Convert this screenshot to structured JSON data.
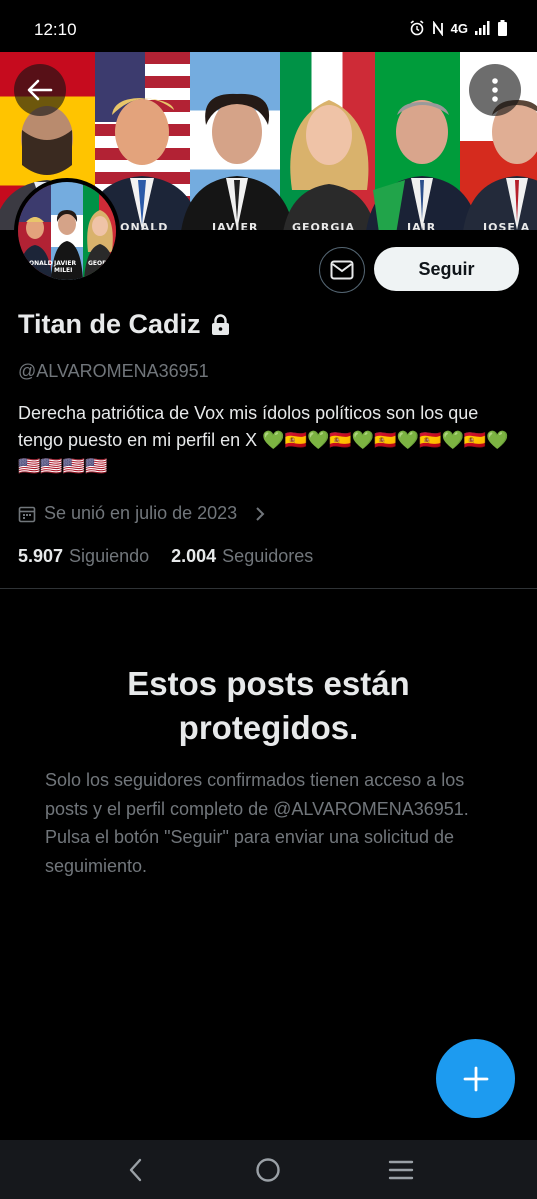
{
  "status_bar": {
    "time": "12:10",
    "network": "4G",
    "icons": [
      "alarm-icon",
      "nfc-icon",
      "signal-icon",
      "battery-icon"
    ]
  },
  "header": {
    "back_icon": "arrow-left-icon",
    "more_icon": "more-vertical-icon",
    "banner_captions": [
      "DONALD",
      "JAVIER",
      "GEORGIA",
      "JAIR",
      "JOSE A"
    ]
  },
  "avatar": {
    "captions": [
      "DONALD",
      "JAVIER MILEI",
      "GEORGIA"
    ]
  },
  "actions": {
    "message_icon": "envelope-icon",
    "follow_label": "Seguir"
  },
  "profile": {
    "display_name": "Titan de Cadiz",
    "lock_icon": "lock-icon",
    "handle": "@ALVAROMENA36951",
    "bio": "Derecha patriótica de Vox mis ídolos políticos son los que tengo puesto en mi perfil en X 💚🇪🇸💚🇪🇸💚🇪🇸💚🇪🇸💚🇪🇸💚🇺🇸🇺🇸🇺🇸🇺🇸",
    "joined": "Se unió en julio de 2023",
    "following_count": "5.907",
    "following_label": "Siguiendo",
    "followers_count": "2.004",
    "followers_label": "Seguidores"
  },
  "protected": {
    "title": "Estos posts están protegidos.",
    "description": "Solo los seguidores confirmados tienen acceso a los posts y el perfil completo de @ALVAROMENA36951. Pulsa el botón \"Seguir\" para enviar una solicitud de seguimiento."
  },
  "fab": {
    "icon": "plus-icon"
  },
  "system_nav": {
    "items": [
      "back-icon",
      "home-icon",
      "recents-icon"
    ]
  },
  "colors": {
    "accent": "#1d9bf0",
    "background": "#000000",
    "text_primary": "#e7e9ea",
    "text_secondary": "#71767b",
    "border": "#2f3336"
  }
}
